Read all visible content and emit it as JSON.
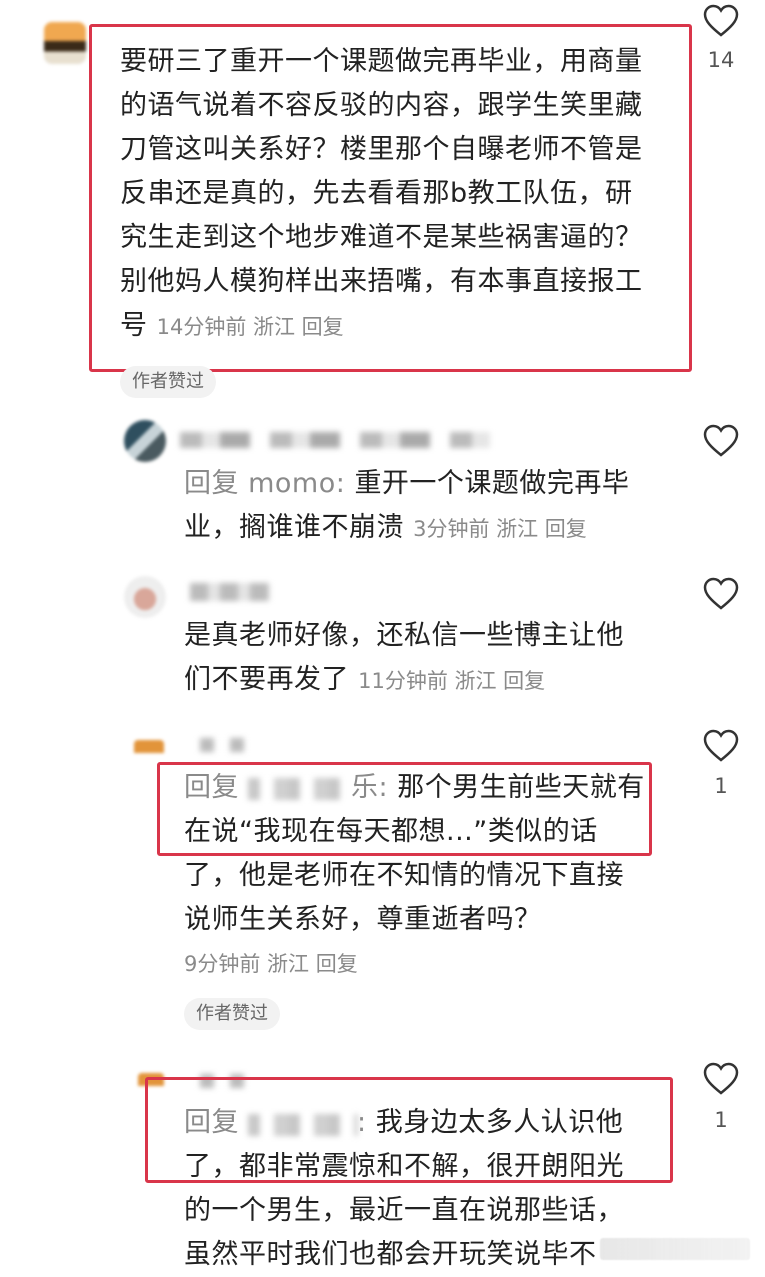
{
  "colors": {
    "highlight_box": "#d9354a",
    "meta_text": "#8a8a8a",
    "badge_bg": "#f2f2f2"
  },
  "comments": [
    {
      "text_lines": [
        "要研三了重开一个课题做完再毕业，用商量",
        "的语气说着不容反驳的内容，跟学生笑里藏",
        "刀管这叫关系好？楼里那个自曝老师不管是",
        "反串还是真的，先去看看那b教工队伍，研",
        "究生走到这个地步难道不是某些祸害逼的？",
        "别他妈人模狗样出来捂嘴，有本事直接报工"
      ],
      "last_line": "号",
      "meta": "14分钟前 浙江 回复",
      "likes": "14",
      "badge": "作者赞过"
    },
    {
      "reply_prefix": "回复",
      "mention": "momo:",
      "line1_text": "重开一个课题做完再毕",
      "line2_text": "业，搁谁谁不崩溃",
      "meta": "3分钟前 浙江 回复"
    },
    {
      "line1_text": "是真老师好像，还私信一些博主让他",
      "line2_text": "们不要再发了",
      "meta": "11分钟前 浙江 回复"
    },
    {
      "reply_prefix": "回复",
      "mention_tail": "乐:",
      "line1_text": "那个男生前些天就有",
      "line2_text": "在说“我现在每天都想...”类似的话",
      "line3_text": "了，他是老师在不知情的情况下直接",
      "line4_text": "说师生关系好，尊重逝者吗？",
      "meta": "9分钟前 浙江 回复",
      "likes": "1",
      "badge": "作者赞过"
    },
    {
      "reply_prefix": "回复",
      "mention_tail": ":",
      "line1_text": "我身边太多人认识他",
      "line2_text": "了，都非常震惊和不解，很开朗阳光",
      "line3_text": "的一个男生，最近一直在说那些话，",
      "line4_text": "虽然平时我们也都会开玩笑说毕不",
      "likes": "1"
    }
  ],
  "icons": [
    "heart-icon"
  ]
}
